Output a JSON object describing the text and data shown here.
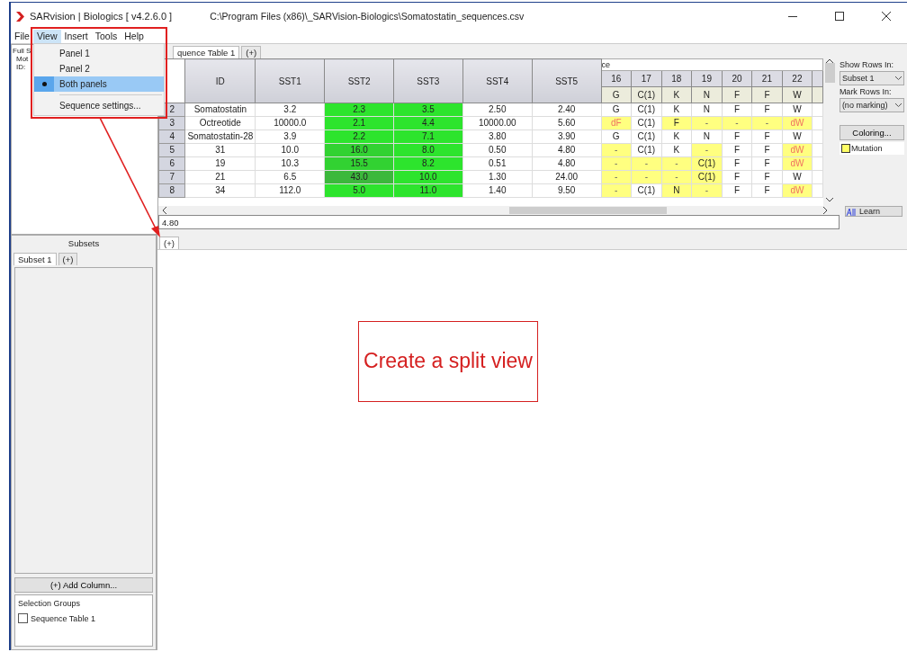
{
  "window": {
    "title": "SARvision | Biologics [ v4.2.6.0 ]",
    "path": "C:\\Program Files (x86)\\_SARVision-Biologics\\Somatostatin_sequences.csv"
  },
  "menu": [
    {
      "label": "File",
      "selected": false
    },
    {
      "label": "View",
      "selected": true
    },
    {
      "label": "Insert",
      "selected": false
    },
    {
      "label": "Tools",
      "selected": false
    },
    {
      "label": "Help",
      "selected": false
    }
  ],
  "view_menu": [
    {
      "kind": "item",
      "label": "Panel 1",
      "checked": false
    },
    {
      "kind": "item",
      "label": "Panel 2",
      "checked": false
    },
    {
      "kind": "item",
      "label": "Both panels",
      "checked": true
    },
    {
      "kind": "separator"
    },
    {
      "kind": "item",
      "label": "Sequence settings...",
      "checked": false
    }
  ],
  "left_panel": {
    "texts": [
      "Full S",
      "Mot",
      "ID:"
    ]
  },
  "table_tabs": [
    {
      "label": "quence Table 1",
      "selected": true
    },
    {
      "label": "(+)",
      "selected": false
    }
  ],
  "table": {
    "columns": [
      "ID",
      "SST1",
      "SST2",
      "SST3",
      "SST4",
      "SST5"
    ],
    "sequence_label": "ce",
    "positions": [
      "16",
      "17",
      "18",
      "19",
      "20",
      "21",
      "22"
    ],
    "reference": [
      "G",
      "C(1)",
      "K",
      "N",
      "F",
      "F",
      "W"
    ],
    "rows": [
      {
        "row": "2",
        "id": "Somatostatin",
        "values": [
          {
            "text": "3.2"
          },
          {
            "text": "2.3",
            "color": "#2de42d"
          },
          {
            "text": "3.5",
            "color": "#2de42d"
          },
          {
            "text": "2.50"
          },
          {
            "text": "2.40"
          }
        ],
        "sequence": [
          {
            "text": "G",
            "kind": "same"
          },
          {
            "text": "C(1)",
            "kind": "same"
          },
          {
            "text": "K",
            "kind": "same"
          },
          {
            "text": "N",
            "kind": "same"
          },
          {
            "text": "F",
            "kind": "same"
          },
          {
            "text": "F",
            "kind": "same"
          },
          {
            "text": "W",
            "kind": "same"
          }
        ]
      },
      {
        "row": "3",
        "id": "Octreotide",
        "values": [
          {
            "text": "10000.0"
          },
          {
            "text": "2.1",
            "color": "#2de42d"
          },
          {
            "text": "4.4",
            "color": "#2de42d"
          },
          {
            "text": "10000.00"
          },
          {
            "text": "5.60"
          }
        ],
        "sequence": [
          {
            "text": "dF",
            "kind": "deletion"
          },
          {
            "text": "C(1)",
            "kind": "same"
          },
          {
            "text": "F",
            "kind": "mutation"
          },
          {
            "text": "-",
            "kind": "gap"
          },
          {
            "text": "-",
            "kind": "gap"
          },
          {
            "text": "-",
            "kind": "gap"
          },
          {
            "text": "dW",
            "kind": "deletion"
          }
        ]
      },
      {
        "row": "4",
        "id": "Somatostatin-28",
        "values": [
          {
            "text": "3.9"
          },
          {
            "text": "2.2",
            "color": "#2de42d"
          },
          {
            "text": "7.1",
            "color": "#2de42d"
          },
          {
            "text": "3.80"
          },
          {
            "text": "3.90"
          }
        ],
        "sequence": [
          {
            "text": "G",
            "kind": "same"
          },
          {
            "text": "C(1)",
            "kind": "same"
          },
          {
            "text": "K",
            "kind": "same"
          },
          {
            "text": "N",
            "kind": "same"
          },
          {
            "text": "F",
            "kind": "same"
          },
          {
            "text": "F",
            "kind": "same"
          },
          {
            "text": "W",
            "kind": "same"
          }
        ]
      },
      {
        "row": "5",
        "id": "31",
        "values": [
          {
            "text": "10.0"
          },
          {
            "text": "16.0",
            "color": "#32d232"
          },
          {
            "text": "8.0",
            "color": "#2de42d"
          },
          {
            "text": "0.50"
          },
          {
            "text": "4.80"
          }
        ],
        "sequence": [
          {
            "text": "-",
            "kind": "gap"
          },
          {
            "text": "C(1)",
            "kind": "same"
          },
          {
            "text": "K",
            "kind": "same"
          },
          {
            "text": "-",
            "kind": "gap"
          },
          {
            "text": "F",
            "kind": "same"
          },
          {
            "text": "F",
            "kind": "same"
          },
          {
            "text": "dW",
            "kind": "deletion"
          }
        ]
      },
      {
        "row": "6",
        "id": "19",
        "values": [
          {
            "text": "10.3"
          },
          {
            "text": "15.5",
            "color": "#32d232"
          },
          {
            "text": "8.2",
            "color": "#2de42d"
          },
          {
            "text": "0.51"
          },
          {
            "text": "4.80"
          }
        ],
        "sequence": [
          {
            "text": "-",
            "kind": "gap"
          },
          {
            "text": "-",
            "kind": "gap"
          },
          {
            "text": "-",
            "kind": "gap"
          },
          {
            "text": "C(1)",
            "kind": "mutation"
          },
          {
            "text": "F",
            "kind": "same"
          },
          {
            "text": "F",
            "kind": "same"
          },
          {
            "text": "dW",
            "kind": "deletion"
          }
        ]
      },
      {
        "row": "7",
        "id": "21",
        "values": [
          {
            "text": "6.5"
          },
          {
            "text": "43.0",
            "color": "#3cb83c"
          },
          {
            "text": "10.0",
            "color": "#2de42d"
          },
          {
            "text": "1.30"
          },
          {
            "text": "24.00"
          }
        ],
        "sequence": [
          {
            "text": "-",
            "kind": "gap"
          },
          {
            "text": "-",
            "kind": "gap"
          },
          {
            "text": "-",
            "kind": "gap"
          },
          {
            "text": "C(1)",
            "kind": "mutation"
          },
          {
            "text": "F",
            "kind": "same"
          },
          {
            "text": "F",
            "kind": "same"
          },
          {
            "text": "W",
            "kind": "same"
          }
        ]
      },
      {
        "row": "8",
        "id": "34",
        "values": [
          {
            "text": "112.0"
          },
          {
            "text": "5.0",
            "color": "#2de42d"
          },
          {
            "text": "11.0",
            "color": "#2de42d"
          },
          {
            "text": "1.40"
          },
          {
            "text": "9.50"
          }
        ],
        "sequence": [
          {
            "text": "-",
            "kind": "gap"
          },
          {
            "text": "C(1)",
            "kind": "same"
          },
          {
            "text": "N",
            "kind": "mutation"
          },
          {
            "text": "-",
            "kind": "gap"
          },
          {
            "text": "F",
            "kind": "same"
          },
          {
            "text": "F",
            "kind": "same"
          },
          {
            "text": "dW",
            "kind": "deletion"
          }
        ]
      }
    ]
  },
  "value_field": "4.80",
  "right_panel": {
    "show_rows_label": "Show Rows In:",
    "show_rows_value": "Subset 1",
    "mark_rows_label": "Mark Rows In:",
    "mark_rows_value": "(no marking)",
    "coloring_button": "Coloring...",
    "legend": [
      {
        "label": "Mutation",
        "color": "#ffff66"
      }
    ],
    "learn_button": "Learn"
  },
  "subsets": {
    "title": "Subsets",
    "tabs": [
      {
        "label": "Subset 1",
        "selected": true
      },
      {
        "label": "(+)",
        "selected": false
      }
    ],
    "add_column": "(+) Add Column...",
    "selection_groups_label": "Selection Groups",
    "groups": [
      {
        "label": "Sequence Table 1",
        "checked": false
      }
    ]
  },
  "panel2_tab": "(+)",
  "annotation": {
    "text": "Create a split view"
  }
}
